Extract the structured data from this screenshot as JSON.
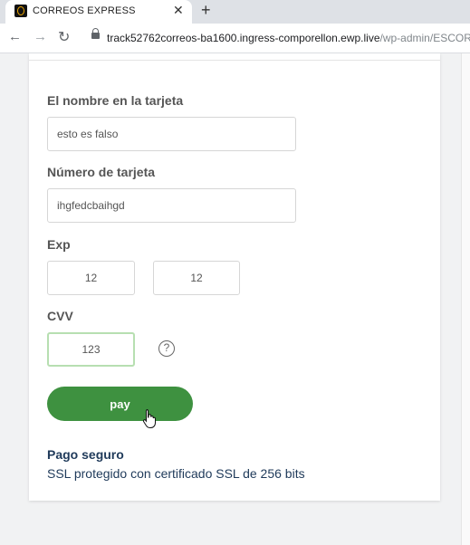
{
  "browser": {
    "tab_title": "CORREOS EXPRESS",
    "tab_close": "✕",
    "new_tab": "+",
    "url_main": "track52762correos-ba1600.ingress-comporellon.ewp.live",
    "url_path": "/wp-admin/ESCORI"
  },
  "form": {
    "name_label": "El nombre en la tarjeta",
    "name_value": "esto es falso",
    "card_label": "Número de tarjeta",
    "card_value": "ihgfedcbaihgd",
    "exp_label": "Exp",
    "exp_month": "12",
    "exp_year": "12",
    "cvv_label": "CVV",
    "cvv_value": "123",
    "help_icon": "?",
    "pay_label": "pay"
  },
  "footer": {
    "secure_title": "Pago seguro",
    "secure_text": "SSL protegido con certificado SSL de 256 bits"
  },
  "colors": {
    "pay_button": "#3e9140",
    "secure_text": "#1f3a5a",
    "cvv_focus_border": "#b7dfb1"
  },
  "icons": [
    "correos-favicon",
    "close-icon",
    "plus-icon",
    "back-arrow-icon",
    "forward-arrow-icon",
    "reload-icon",
    "lock-icon",
    "question-circle-icon",
    "hand-cursor-icon"
  ]
}
